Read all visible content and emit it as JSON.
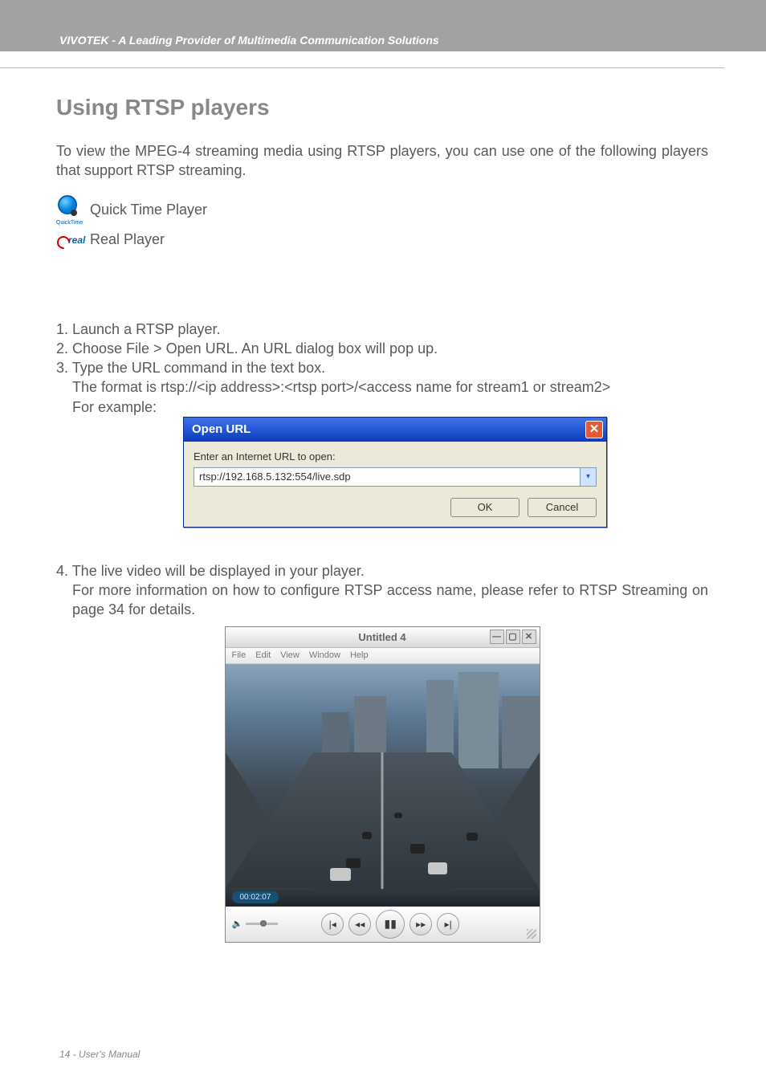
{
  "header": {
    "brand": "VIVOTEK - A Leading Provider of Multimedia Communication Solutions"
  },
  "page": {
    "title": "Using RTSP players",
    "intro": "To view the MPEG-4 streaming media using RTSP players, you can use one of the following players that support RTSP streaming.",
    "players": {
      "quicktime": "Quick Time Player",
      "quicktime_caption": "QuickTime",
      "real": "Real Player",
      "real_logo_text": "real"
    },
    "steps": {
      "s1": "1. Launch a RTSP player.",
      "s2": "2. Choose File > Open URL. An URL dialog box will pop up.",
      "s3": "3. Type the URL command in the text box.",
      "s3b": "The format is rtsp://<ip address>:<rtsp port>/<access name for stream1 or stream2>",
      "example_label": "For example:"
    },
    "step4": {
      "a": "4. The live video will be displayed in your player.",
      "b": "For more information on how to configure RTSP access name, please refer to RTSP Streaming on page 34 for details."
    }
  },
  "dialog": {
    "title": "Open URL",
    "label": "Enter an Internet URL to open:",
    "value": "rtsp://192.168.5.132:554/live.sdp",
    "ok": "OK",
    "cancel": "Cancel"
  },
  "player_window": {
    "title": "Untitled 4",
    "menu": [
      "File",
      "Edit",
      "View",
      "Window",
      "Help"
    ],
    "time": "00:02:07"
  },
  "footer": {
    "text": "14 - User's Manual"
  }
}
